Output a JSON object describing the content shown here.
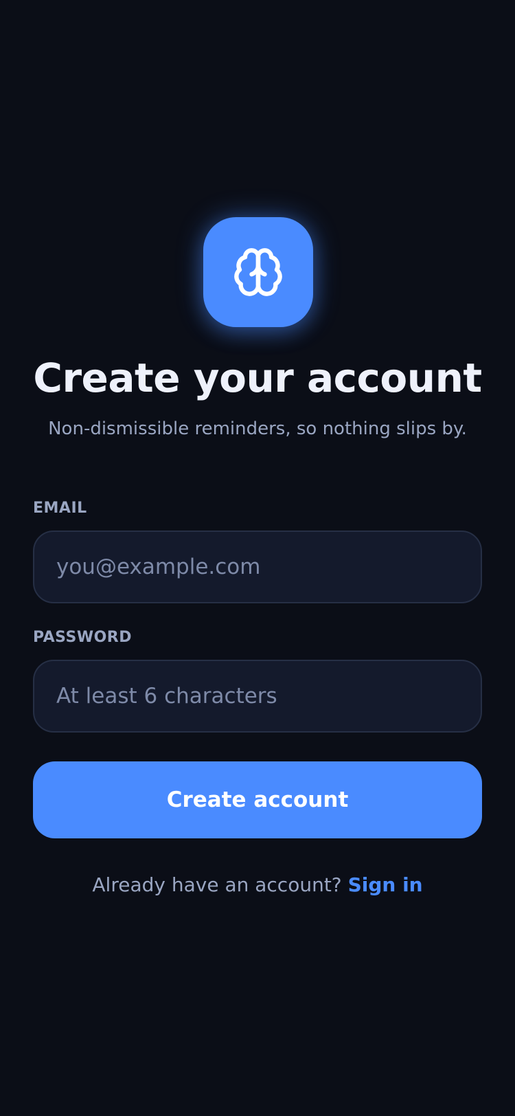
{
  "app": {
    "logo_icon": "brain-icon",
    "accent_color": "#4a8bff",
    "background_color": "#0b0e17"
  },
  "header": {
    "title": "Create your account",
    "subtitle": "Non-dismissible reminders, so nothing slips by."
  },
  "form": {
    "email": {
      "label": "EMAIL",
      "value": "",
      "placeholder": "you@example.com"
    },
    "password": {
      "label": "PASSWORD",
      "value": "",
      "placeholder": "At least 6 characters"
    },
    "submit_label": "Create account"
  },
  "footer": {
    "prompt": "Already have an account?",
    "link_label": "Sign in"
  }
}
